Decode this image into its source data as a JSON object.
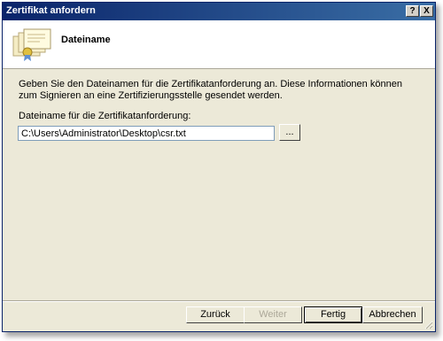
{
  "window": {
    "title": "Zertifikat anfordern",
    "help_glyph": "?",
    "close_glyph": "X"
  },
  "header": {
    "title": "Dateiname",
    "icon": "certificate-icon"
  },
  "body": {
    "description": "Geben Sie den Dateinamen für die Zertifikatanforderung an. Diese Informationen können zum Signieren an eine Zertifizierungsstelle gesendet werden.",
    "field_label": "Dateiname für die Zertifikatanforderung:",
    "filename_value": "C:\\Users\\Administrator\\Desktop\\csr.txt",
    "browse_label": "..."
  },
  "buttons": {
    "back": "Zurück",
    "next": "Weiter",
    "finish": "Fertig",
    "cancel": "Abbrechen"
  },
  "colors": {
    "titlebar": "#0a246a",
    "face": "#ece9d8"
  }
}
